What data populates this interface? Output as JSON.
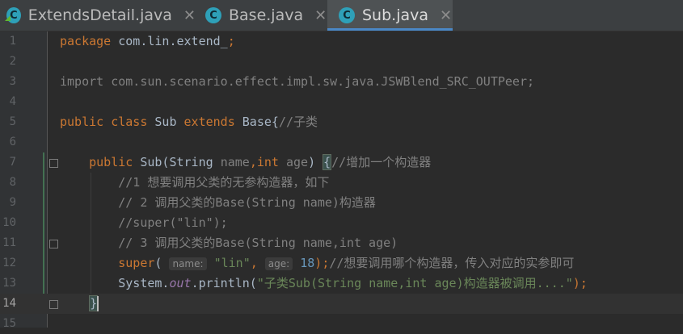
{
  "tabs": [
    {
      "label": "ExtendsDetail.java",
      "icon": "class-c-icon",
      "active": false
    },
    {
      "label": "Base.java",
      "icon": "class-c-icon",
      "active": false
    },
    {
      "label": "Sub.java",
      "icon": "class-c-icon",
      "active": true
    }
  ],
  "close_glyph": "✕",
  "lines": [
    {
      "number": "1",
      "segments": [
        {
          "t": "package",
          "c": "kw"
        },
        {
          "t": " com.lin.extend_",
          "c": ""
        },
        {
          "t": ";",
          "c": "kw"
        }
      ]
    },
    {
      "number": "2",
      "segments": []
    },
    {
      "number": "3",
      "segments": [
        {
          "t": "import com.sun.scenario.effect.impl.sw.java.JSWBlend_SRC_OUTPeer;",
          "c": "dim"
        }
      ]
    },
    {
      "number": "4",
      "segments": []
    },
    {
      "number": "5",
      "segments": [
        {
          "t": "public class",
          "c": "kw"
        },
        {
          "t": " Sub ",
          "c": ""
        },
        {
          "t": "extends",
          "c": "kw"
        },
        {
          "t": " Base{",
          "c": ""
        },
        {
          "t": "//子类",
          "c": "cm"
        }
      ]
    },
    {
      "number": "6",
      "segments": []
    },
    {
      "number": "7",
      "segments": [
        {
          "t": "    public ",
          "c": "kw"
        },
        {
          "t": "Sub(String ",
          "c": ""
        },
        {
          "t": "name",
          "c": "dim"
        },
        {
          "t": ",",
          "c": "kw"
        },
        {
          "t": "int ",
          "c": "kw"
        },
        {
          "t": "age",
          "c": "dim"
        },
        {
          "t": ") ",
          "c": ""
        },
        {
          "t": "{",
          "c": "brace"
        },
        {
          "t": "//增加一个构造器",
          "c": "cm"
        }
      ]
    },
    {
      "number": "8",
      "segments": [
        {
          "t": "        //1 想要调用父类的无参构造器，如下",
          "c": "cm"
        }
      ]
    },
    {
      "number": "9",
      "segments": [
        {
          "t": "        // 2 调用父类的Base(String name)构造器",
          "c": "cm"
        }
      ]
    },
    {
      "number": "10",
      "segments": [
        {
          "t": "        //super(\"lin\");",
          "c": "cm"
        }
      ]
    },
    {
      "number": "11",
      "segments": [
        {
          "t": "        // 3 调用父类的Base(String name,int age)",
          "c": "cm"
        }
      ]
    },
    {
      "number": "12",
      "segments": [
        {
          "t": "        ",
          "c": ""
        },
        {
          "t": "super",
          "c": "kw"
        },
        {
          "t": "( ",
          "c": ""
        },
        {
          "t": "name:",
          "c": "hint"
        },
        {
          "t": " ",
          "c": ""
        },
        {
          "t": "\"lin\"",
          "c": "str"
        },
        {
          "t": ", ",
          "c": "kw"
        },
        {
          "t": "age:",
          "c": "hint"
        },
        {
          "t": " ",
          "c": ""
        },
        {
          "t": "18",
          "c": "num"
        },
        {
          "t": ");",
          "c": "kw"
        },
        {
          "t": "//想要调用哪个构造器，传入对应的实参即可",
          "c": "cm"
        }
      ]
    },
    {
      "number": "13",
      "segments": [
        {
          "t": "        System.",
          "c": ""
        },
        {
          "t": "out",
          "c": "fld"
        },
        {
          "t": ".println(",
          "c": ""
        },
        {
          "t": "\"子类Sub(String name,int age)构造器被调用....\"",
          "c": "str"
        },
        {
          "t": ");",
          "c": "kw"
        }
      ]
    },
    {
      "number": "14",
      "current": true,
      "segments": [
        {
          "t": "    ",
          "c": ""
        },
        {
          "t": "}",
          "c": "brace"
        },
        {
          "t": "",
          "c": "caret"
        }
      ]
    },
    {
      "number": "15",
      "segments": []
    }
  ]
}
